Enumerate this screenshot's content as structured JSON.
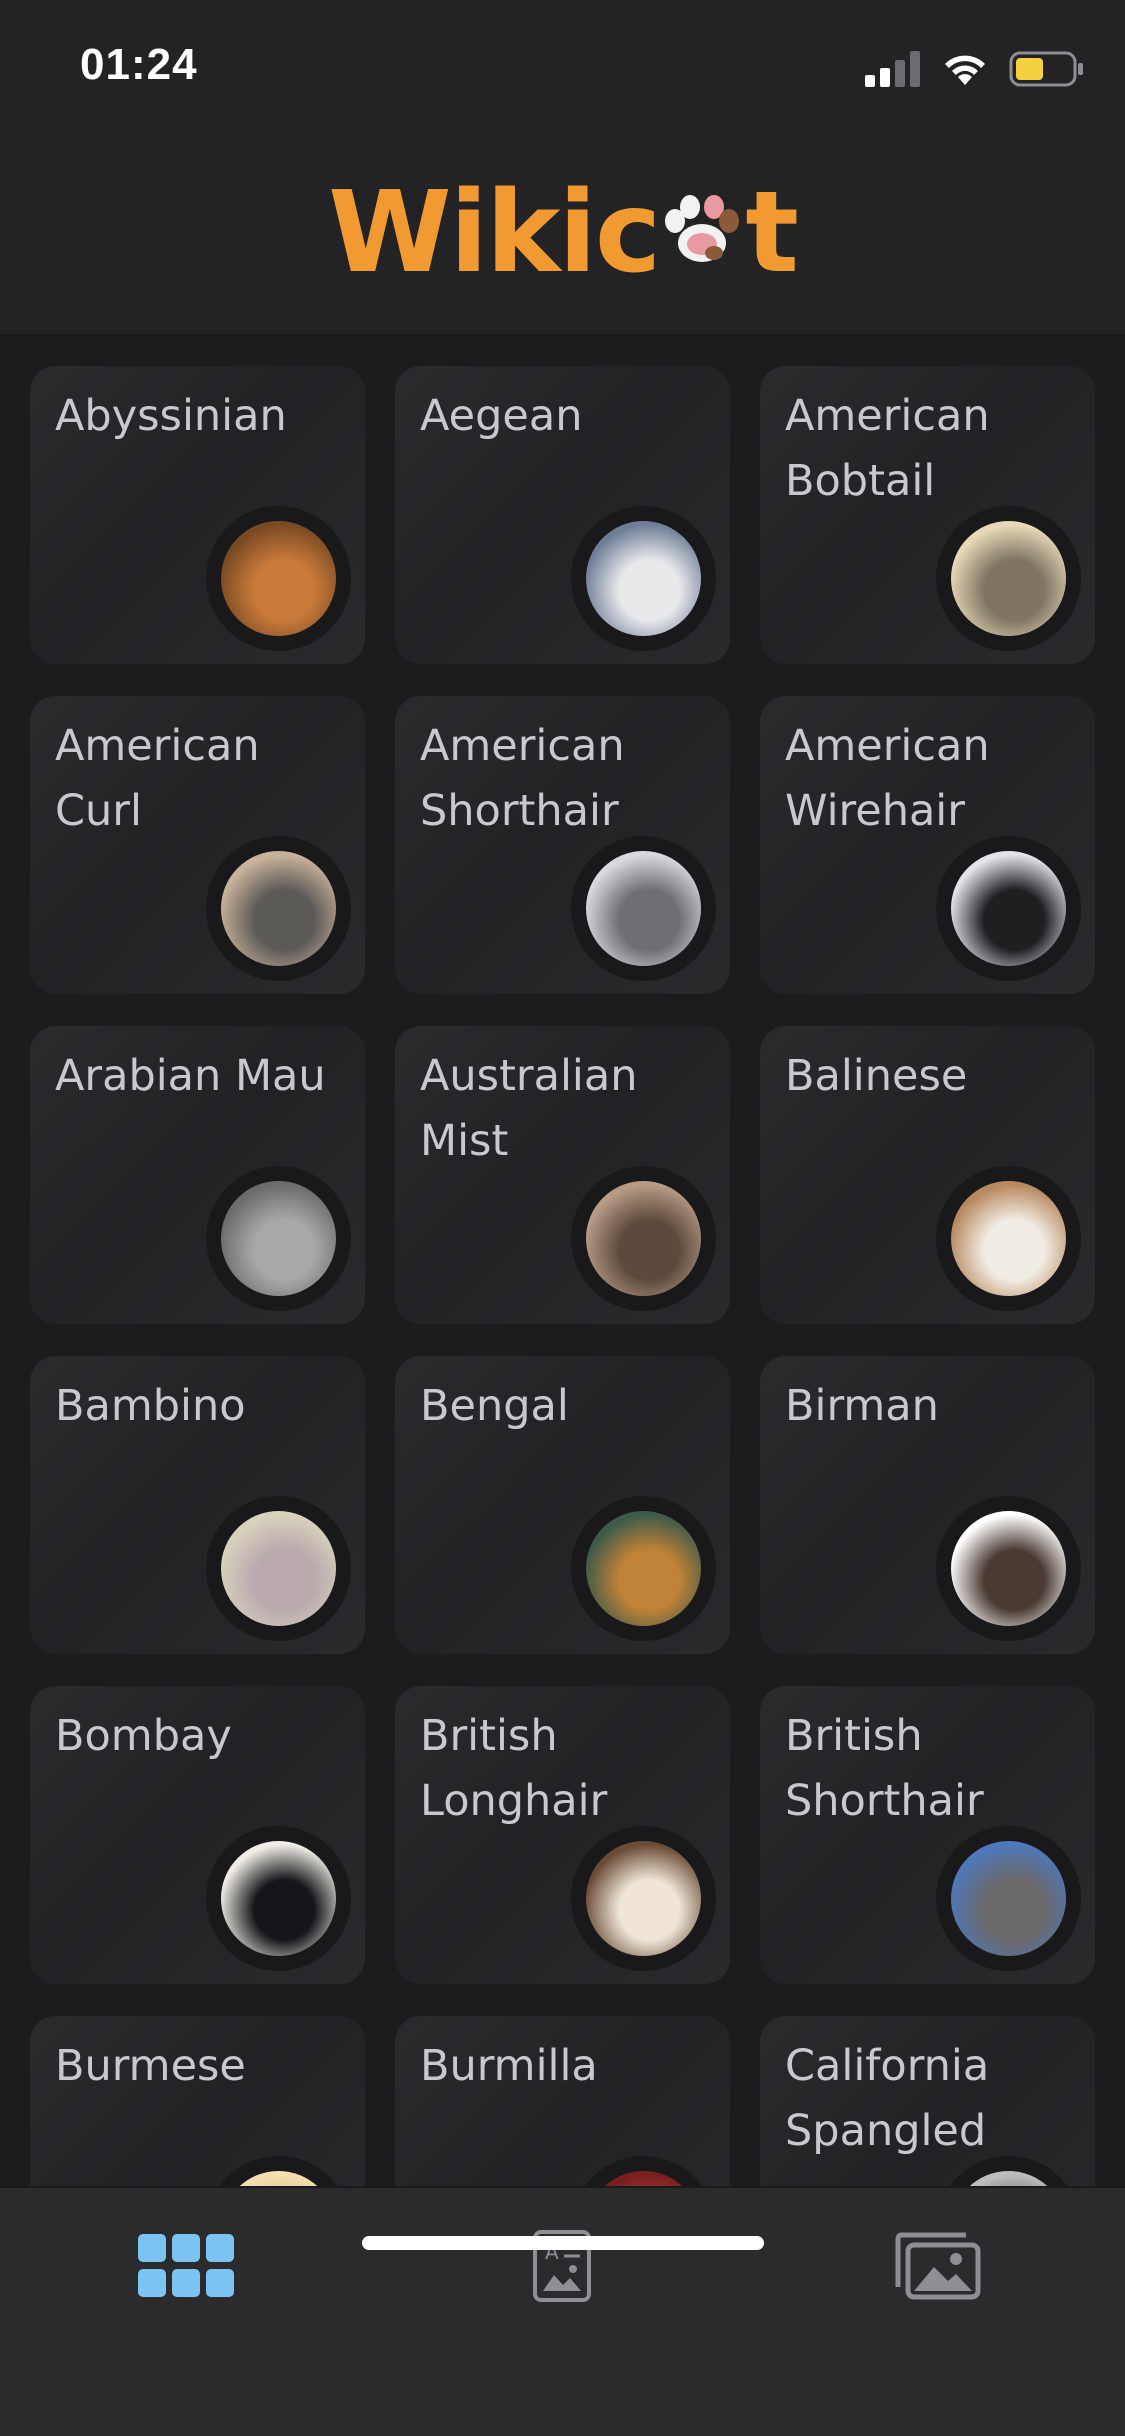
{
  "status_bar": {
    "time": "01:24",
    "battery_color": "#f5d142"
  },
  "app": {
    "logo_text_before": "Wikic",
    "logo_text_after": "t",
    "logo_color": "#f29a32"
  },
  "breeds": [
    {
      "name": "Abyssinian",
      "photo": "orange-cat-photo",
      "bg": "#7a4a22",
      "fg": "#c97a3b"
    },
    {
      "name": "Aegean",
      "photo": "white-gray-cat-photo",
      "bg": "#6f7e97",
      "fg": "#e9e9ec"
    },
    {
      "name": "American Bobtail",
      "photo": "tabby-cat-photo",
      "bg": "#e8d8b8",
      "fg": "#7f7563"
    },
    {
      "name": "American Curl",
      "photo": "silver-tabby-cat-photo",
      "bg": "#c9b29a",
      "fg": "#5c5a57"
    },
    {
      "name": "American Shorthair",
      "photo": "silver-tabby-cat-photo",
      "bg": "#d7d9dc",
      "fg": "#6d6f73"
    },
    {
      "name": "American Wirehair",
      "photo": "black-white-cat-photo",
      "bg": "#e3e4ea",
      "fg": "#1f1f22"
    },
    {
      "name": "Arabian Mau",
      "photo": "gray-tabby-cat-photo",
      "bg": "#6c6c6c",
      "fg": "#a8a8a6"
    },
    {
      "name": "Australian Mist",
      "photo": "brown-tabby-cat-photo",
      "bg": "#b79b86",
      "fg": "#5e4a3d"
    },
    {
      "name": "Balinese",
      "photo": "cream-cat-photo",
      "bg": "#b8895f",
      "fg": "#f1ece4"
    },
    {
      "name": "Bambino",
      "photo": "hairless-cat-photo",
      "bg": "#d8d2bd",
      "fg": "#b9a9ad"
    },
    {
      "name": "Bengal",
      "photo": "bengal-cat-photo",
      "bg": "#3d5a4a",
      "fg": "#c08236"
    },
    {
      "name": "Birman",
      "photo": "birman-cat-photo",
      "bg": "#ffffff",
      "fg": "#4a3a33"
    },
    {
      "name": "Bombay",
      "photo": "black-cat-photo",
      "bg": "#f0ede6",
      "fg": "#15161a"
    },
    {
      "name": "British Longhair",
      "photo": "fluffy-cat-photo",
      "bg": "#6b4c36",
      "fg": "#efe6d8"
    },
    {
      "name": "British Shorthair",
      "photo": "gray-cat-photo",
      "bg": "#4e78b8",
      "fg": "#6a6869"
    },
    {
      "name": "Burmese",
      "photo": "cat-photo",
      "bg": "#f4dfb0",
      "fg": "#d9b77b"
    },
    {
      "name": "Burmilla",
      "photo": "cat-photo",
      "bg": "#7a1f1f",
      "fg": "#c24040"
    },
    {
      "name": "California Spangled",
      "photo": "cat-photo",
      "bg": "#bdbdbd",
      "fg": "#5a5a5a"
    }
  ],
  "tabs": [
    {
      "name": "breeds-grid",
      "active": true,
      "color": "#7cc4f2"
    },
    {
      "name": "breed-info",
      "active": false,
      "color": "#8e8e93"
    },
    {
      "name": "gallery",
      "active": false,
      "color": "#8e8e93"
    }
  ]
}
